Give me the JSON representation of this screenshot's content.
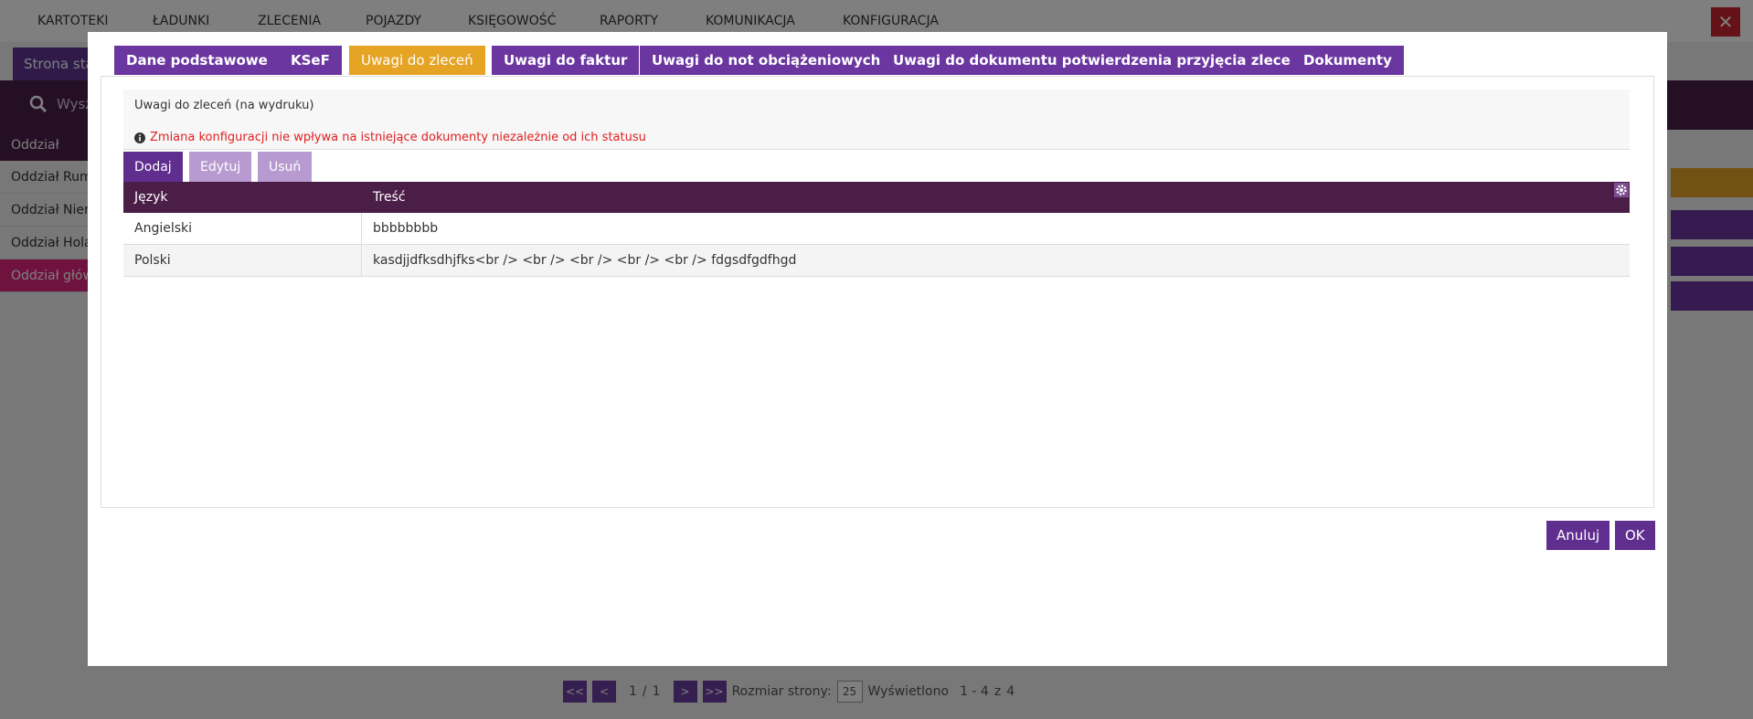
{
  "app": {
    "menu": [
      "KARTOTEKI",
      "ŁADUNKI",
      "ZLECENIA",
      "POJAZDY",
      "KSIĘGOWOŚĆ",
      "RAPORTY",
      "KOMUNIKACJA",
      "KONFIGURACJA"
    ],
    "close_label": "✕",
    "start_tab": "Strona startowa",
    "search_placeholder": "Wyszukaj",
    "list_header": "Oddział",
    "list_rows": [
      "Oddział Rumunia",
      "Oddział Niemcy",
      "Oddział Holandia",
      "Oddział główny"
    ],
    "pager": {
      "first": "<<",
      "prev": "<",
      "current": "1",
      "sep": "/",
      "total": "1",
      "next": ">",
      "last": ">>",
      "size_label": "Rozmiar strony:",
      "size_value": "25",
      "shown_label": "Wyświetlono",
      "shown_range": "1 - 4",
      "of_label": "z",
      "shown_total": "4"
    }
  },
  "modal": {
    "tabs": [
      "Dane podstawowe",
      "KSeF",
      "Uwagi do zleceń",
      "Uwagi do faktur",
      "Uwagi do not obciążeniowych",
      "Uwagi do dokumentu potwierdzenia przyjęcia zlecenia",
      "Dokumenty"
    ],
    "active_tab": "Uwagi do zleceń",
    "panel_title": "Uwagi do zleceń (na wydruku)",
    "warning": "Zmiana konfiguracji nie wpływa na istniejące dokumenty niezależnie od ich statusu",
    "toolbar": {
      "add": "Dodaj",
      "edit": "Edytuj",
      "remove": "Usuń"
    },
    "table": {
      "columns": [
        "Język",
        "Treść"
      ],
      "rows": [
        [
          "Angielski",
          "bbbbbbbb"
        ],
        [
          "Polski",
          "kasdjjdfksdhjfks<br /> <br /> <br /> <br /> <br /> fdgsdfgdfhgd"
        ]
      ]
    },
    "buttons": {
      "cancel": "Anuluj",
      "ok": "OK"
    }
  },
  "colors": {
    "accent_purple": "#6b36a0",
    "header_dark": "#4b1e48",
    "active_tab_orange": "#e5a424",
    "warning_red": "#e02020"
  }
}
